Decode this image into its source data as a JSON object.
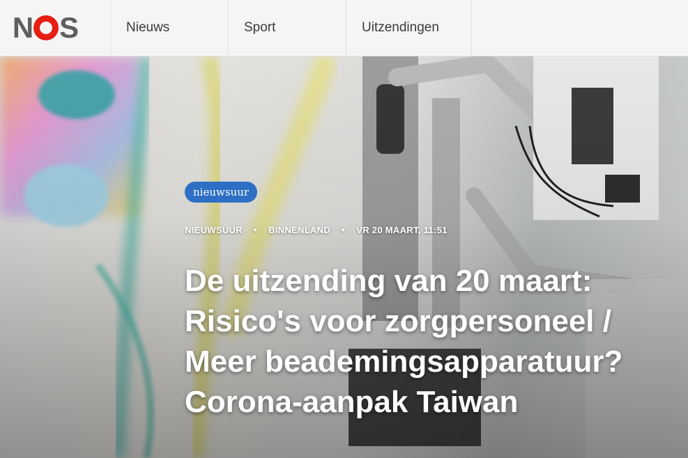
{
  "header": {
    "logo": {
      "letter_n": "N",
      "letter_s": "S",
      "accent": "#e61e14"
    },
    "nav": [
      {
        "label": "Nieuws"
      },
      {
        "label": "Sport"
      },
      {
        "label": "Uitzendingen"
      }
    ]
  },
  "hero": {
    "badge": "nieuwsuur",
    "meta": {
      "program": "NIEUWSUUR",
      "category": "BINNENLAND",
      "datetime": "VR 20 MAART, 11:51",
      "separator": "•"
    },
    "headline_lines": [
      "De uitzending van 20 maart:",
      "Risico's voor zorgpersoneel /",
      "Meer beademingsapparatuur?",
      "Corona-aanpak Taiwan"
    ],
    "photo_label": "hospital ventilator equipment photo"
  }
}
